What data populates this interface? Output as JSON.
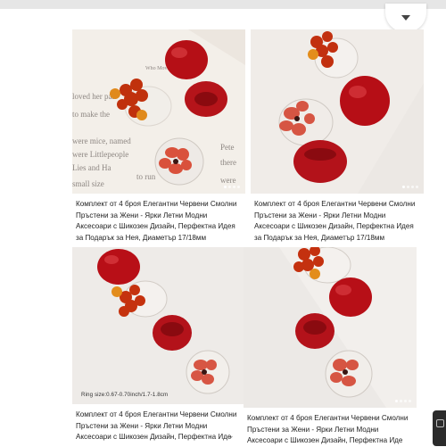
{
  "accent_color": "#c0141a",
  "menu": {
    "icon": "dropdown-triangle-icon"
  },
  "products": [
    {
      "title": "Комплект от 4 броя Елегантни Червени Смолни Пръстени за Жени - Ярки Летни Модни Аксесоари с Шикозен Дизайн, Перфектна Идея за Подарък за Нея, Диаметър 17/18мм"
    },
    {
      "title": "Комплект от 4 броя Елегантни Червени Смолни Пръстени за Жени - Ярки Летни Модни Аксесоари с Шикозен Дизайн, Перфектна Идея за Подарък за Нея, Диаметър 17/18мм"
    },
    {
      "title": "Комплект от 4 броя Елегантни Червени Смолни Пръстени за Жени - Ярки Летни Модни Аксесоари с Шикозен Дизайн, Перфектна Иде",
      "ring_size_caption": "Ring size:0.67-0.70inch/1.7-1.8cm",
      "expand_icon": "chevron-down-icon"
    },
    {
      "title": "Комплект от 4 броя Елегантни Червени Смолни Пръстени за Жени - Ярки Летни Модни Аксесоари с Шикозен Дизайн, Перфектна Иде"
    }
  ],
  "book_text": {
    "heading_left": "Who Moved M",
    "lines": [
      "loved her pair",
      "to make the",
      "were mice, named",
      "were Littlepeople",
      "Lies and Ha",
      "small size",
      "to run",
      "there",
      "were",
      "Pete"
    ]
  }
}
